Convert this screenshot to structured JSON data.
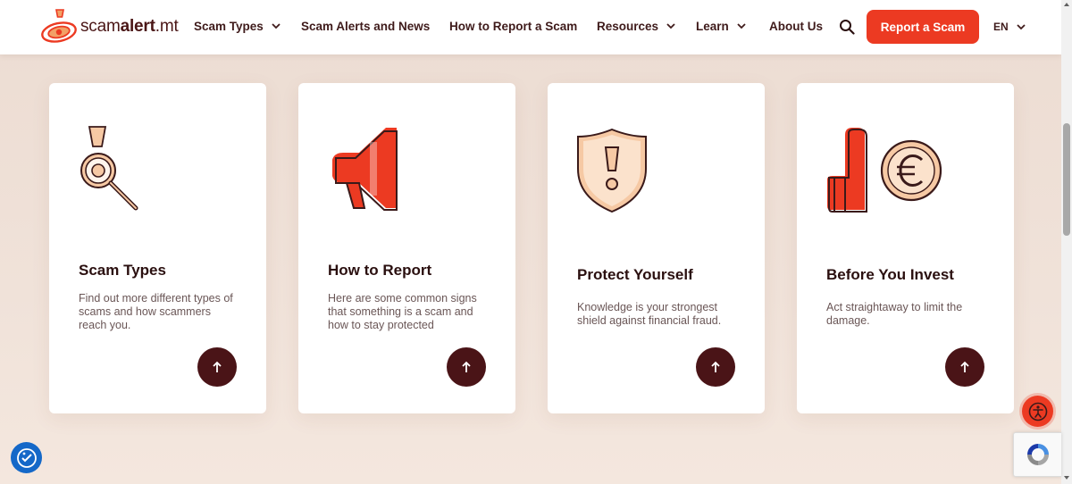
{
  "header": {
    "logo": {
      "text_regular": "scam",
      "text_bold": "alert",
      "text_suffix": ".mt"
    },
    "nav": [
      {
        "label": "Scam Types",
        "has_dropdown": true
      },
      {
        "label": "Scam Alerts and News",
        "has_dropdown": false
      },
      {
        "label": "How to Report a Scam",
        "has_dropdown": false
      },
      {
        "label": "Resources",
        "has_dropdown": true
      },
      {
        "label": "Learn",
        "has_dropdown": true
      },
      {
        "label": "About Us",
        "has_dropdown": false
      }
    ],
    "search_icon": "search-icon",
    "report_button": "Report a Scam",
    "language": "EN"
  },
  "cards": [
    {
      "icon": "magnifier-icon",
      "title": "Scam Types",
      "description": "Find out more different types of scams and how scammers reach you."
    },
    {
      "icon": "megaphone-icon",
      "title": "How to Report",
      "description": "Here are some common signs that something is a scam and how to stay protected"
    },
    {
      "icon": "shield-alert-icon",
      "title": "Protect Yourself",
      "description": "Knowledge is your strongest shield against financial fraud."
    },
    {
      "icon": "hand-stop-euro-icon",
      "title": "Before You Invest",
      "description": "Act straightaway to limit the damage."
    }
  ],
  "colors": {
    "brand_red": "#ec3a22",
    "dark_maroon": "#4a1417",
    "peach": "#f6c9a4",
    "background": "#efe1d7"
  }
}
